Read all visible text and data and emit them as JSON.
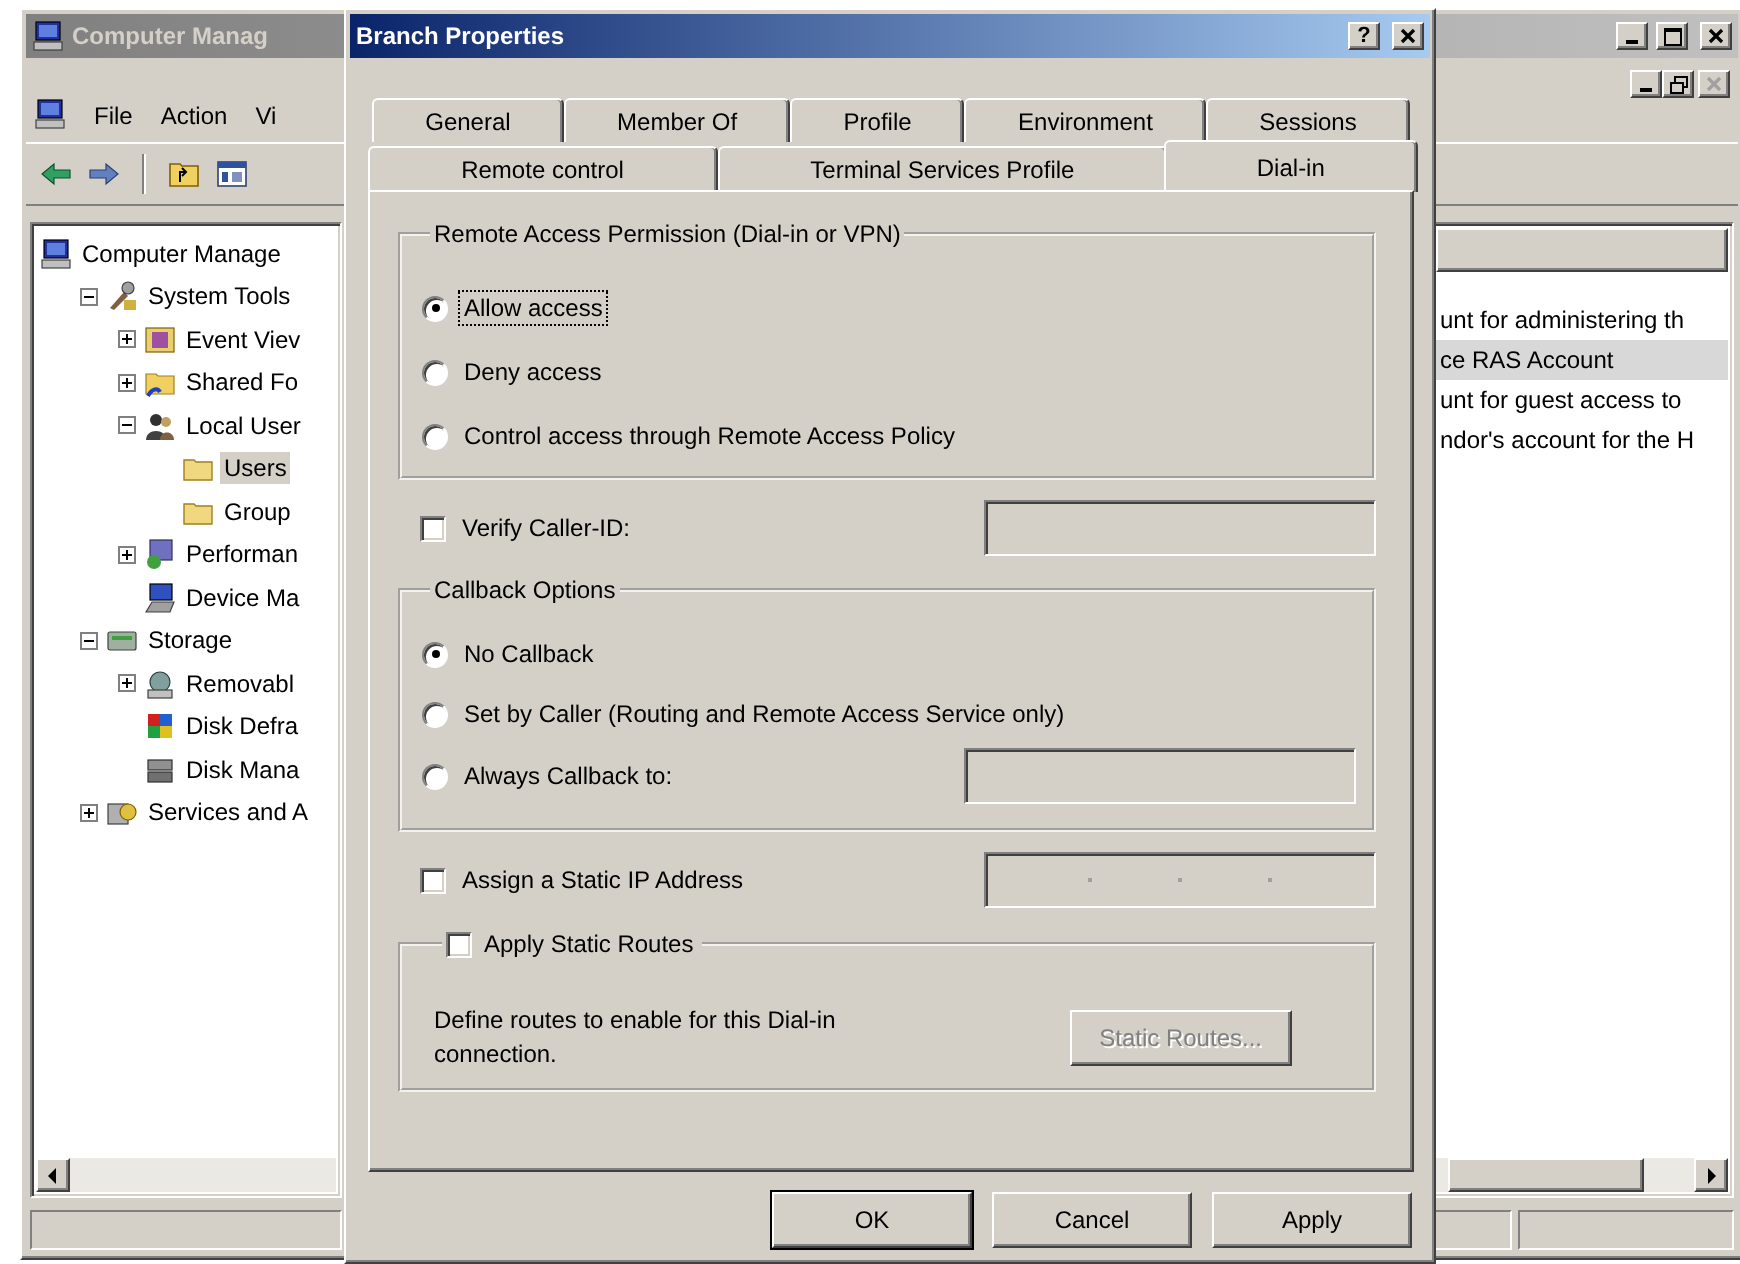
{
  "main_window": {
    "title": "Computer Manag",
    "active": false,
    "menu": [
      "File",
      "Action",
      "Vi"
    ],
    "tree": [
      {
        "label": "Computer Manage",
        "kind": "computer",
        "selected": false,
        "children": [
          {
            "label": "System Tools",
            "kind": "tools",
            "expanded": true,
            "selected": false,
            "children": [
              {
                "label": "Event Viev",
                "kind": "log",
                "expanded": false,
                "selected": false
              },
              {
                "label": "Shared Fo",
                "kind": "share",
                "expanded": false,
                "selected": false
              },
              {
                "label": "Local User",
                "kind": "users",
                "expanded": true,
                "selected": false,
                "children": [
                  {
                    "label": "Users",
                    "kind": "folder",
                    "selected": true
                  },
                  {
                    "label": "Group",
                    "kind": "folder",
                    "selected": false
                  }
                ]
              },
              {
                "label": "Performan",
                "kind": "perf",
                "expanded": false,
                "selected": false
              },
              {
                "label": "Device Ma",
                "kind": "device",
                "selected": false
              }
            ]
          },
          {
            "label": "Storage",
            "kind": "storage",
            "expanded": true,
            "selected": false,
            "children": [
              {
                "label": "Removabl",
                "kind": "drive",
                "expanded": false,
                "selected": false
              },
              {
                "label": "Disk Defra",
                "kind": "defrag",
                "selected": false
              },
              {
                "label": "Disk Mana",
                "kind": "disk",
                "selected": false
              }
            ]
          },
          {
            "label": "Services and A",
            "kind": "services",
            "expanded": false,
            "selected": false
          }
        ]
      }
    ],
    "list_rows": [
      {
        "text": "unt for administering th",
        "selected": false
      },
      {
        "text": "ce RAS Account",
        "selected": true
      },
      {
        "text": "unt for guest access to",
        "selected": false
      },
      {
        "text": "ndor's account for the H",
        "selected": false
      }
    ]
  },
  "dialog": {
    "title": "Branch Properties",
    "active": true,
    "help_button": "?",
    "tab_rows": [
      [
        {
          "label": "General",
          "selected": false
        },
        {
          "label": "Member Of",
          "selected": false
        },
        {
          "label": "Profile",
          "selected": false
        },
        {
          "label": "Environment",
          "selected": false
        },
        {
          "label": "Sessions",
          "selected": false
        }
      ],
      [
        {
          "label": "Remote control",
          "selected": false
        },
        {
          "label": "Terminal Services Profile",
          "selected": false
        },
        {
          "label": "Dial-in",
          "selected": true
        }
      ]
    ],
    "remote_access": {
      "title": "Remote Access Permission (Dial-in or VPN)",
      "options": [
        {
          "label": "Allow access",
          "selected": true,
          "focused": true
        },
        {
          "label": "Deny access",
          "selected": false,
          "focused": false
        },
        {
          "label": "Control access through Remote Access Policy",
          "selected": false,
          "focused": false
        }
      ]
    },
    "verify_caller_id": {
      "label": "Verify Caller-ID:",
      "checked": false,
      "field": {
        "kind": "text",
        "disabled": true
      }
    },
    "callback": {
      "title": "Callback Options",
      "options": [
        {
          "label": "No Callback",
          "selected": true
        },
        {
          "label": "Set by Caller (Routing and Remote Access Service only)",
          "selected": false
        },
        {
          "label": "Always Callback to:",
          "selected": false,
          "field": {
            "kind": "text",
            "disabled": true
          }
        }
      ]
    },
    "static_ip": {
      "label": "Assign a Static IP Address",
      "checked": false,
      "field": {
        "kind": "ip",
        "disabled": true
      }
    },
    "static_routes": {
      "label": "Apply Static Routes",
      "checked": false,
      "description": "Define routes to enable for this Dial-in connection.",
      "button": {
        "label": "Static Routes...",
        "disabled": true
      }
    },
    "buttons": [
      {
        "label": "OK",
        "default": true
      },
      {
        "label": "Cancel",
        "default": false
      },
      {
        "label": "Apply",
        "default": false
      }
    ]
  }
}
